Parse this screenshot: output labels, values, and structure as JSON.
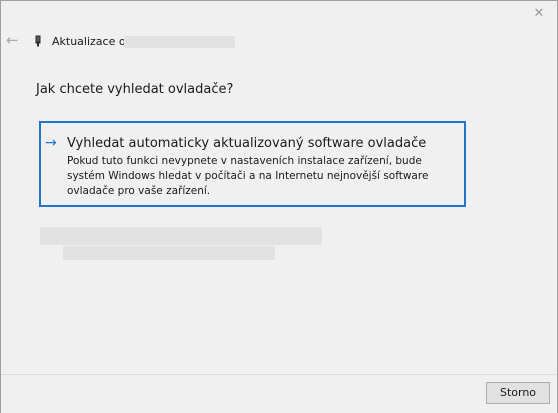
{
  "window": {
    "title": "Aktualizace ovladačů",
    "close_glyph": "✕",
    "back_glyph": "←"
  },
  "main": {
    "heading": "Jak chcete vyhledat ovladače?",
    "option": {
      "arrow_glyph": "→",
      "title": "Vyhledat automaticky aktualizovaný software ovladače",
      "description": "Pokud tuto funkci nevypnete v nastaveních instalace zařízení, bude systém Windows hledat v počítači a na Internetu nejnovější software ovladače pro vaše zařízení."
    }
  },
  "footer": {
    "cancel_label": "Storno"
  },
  "colors": {
    "accent": "#1f75c9",
    "background": "#f0f0f0"
  },
  "icons": {
    "back": "back-arrow-icon",
    "close": "close-icon",
    "device": "device-icon",
    "option_arrow": "arrow-right-icon"
  }
}
